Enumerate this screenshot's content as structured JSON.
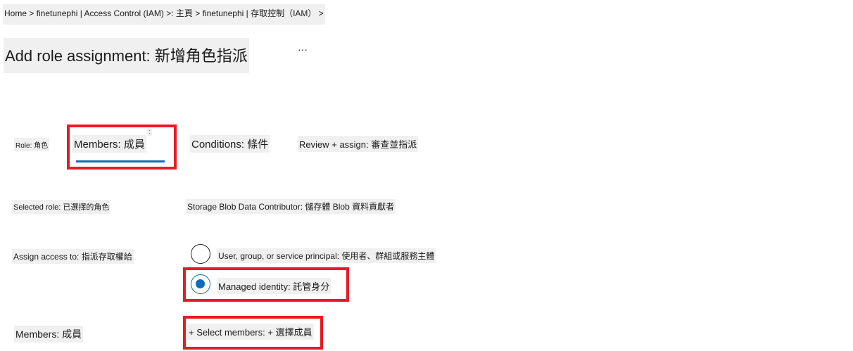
{
  "breadcrumb": "Home > finetunephi | Access Control (IAM) >: 主頁 > finetunephi | 存取控制（IAM） >",
  "title": "Add role assignment: 新增角色指派",
  "more_label": "···",
  "tabs": [
    {
      "label": "Role: 角色"
    },
    {
      "label": "Members: 成員",
      "selected": true
    },
    {
      "label": "Conditions: 條件"
    },
    {
      "label": "Review + assign: 審查並指派"
    }
  ],
  "tab_marker": ":",
  "selected_role": {
    "label": "Selected role: 已選擇的角色",
    "value": "Storage Blob Data Contributor: 儲存體 Blob 資料貢獻者"
  },
  "assign_access": {
    "label": "Assign access to: 指派存取權給",
    "options": [
      {
        "label": "User, group, or service principal: 使用者、群組或服務主體",
        "checked": false
      },
      {
        "label": "Managed identity: 託管身分",
        "checked": true
      }
    ]
  },
  "members": {
    "label": "Members: 成員",
    "select_label": "+ Select members: + 選擇成員"
  },
  "colors": {
    "accent": "#0f6cbd",
    "highlight": "#e81b23"
  }
}
